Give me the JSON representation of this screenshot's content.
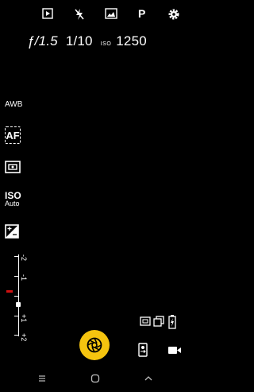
{
  "top_bar": {
    "icons": [
      "play-icon",
      "flash-off-icon",
      "gallery-icon",
      "mode-icon",
      "settings-icon"
    ],
    "mode_label": "P"
  },
  "readout": {
    "aperture": "ƒ/1.5",
    "shutter_speed": "1/10",
    "iso_label": "ISO",
    "iso_value": "1250"
  },
  "side_panel": {
    "white_balance": "AWB",
    "focus": "AF",
    "iso_title": "ISO",
    "iso_mode": "Auto"
  },
  "exposure_scale": {
    "labels": [
      "-2",
      "-1",
      "0",
      "+1",
      "+2"
    ],
    "current_value": -1
  },
  "colors": {
    "shutter_button": "#f5c40f",
    "indicator": "#d01010"
  }
}
